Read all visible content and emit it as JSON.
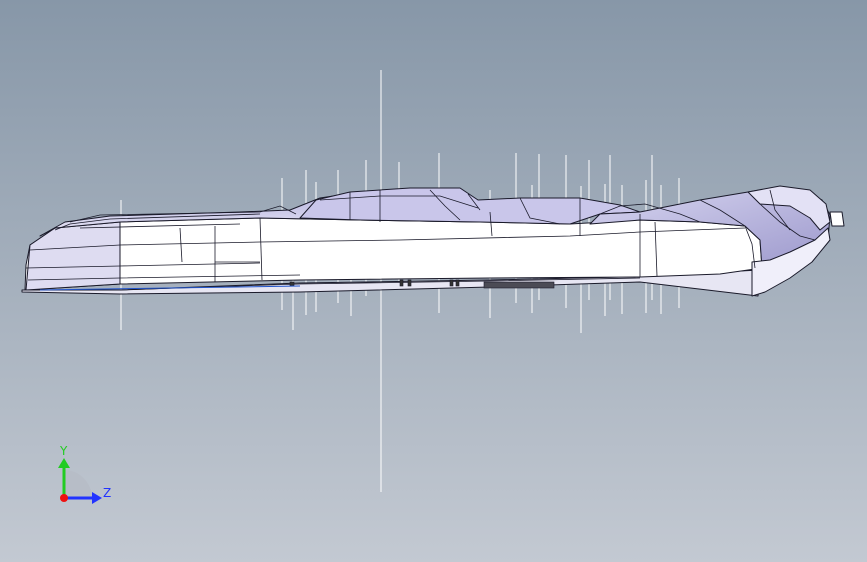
{
  "viewport": {
    "background_top": "#8797a8",
    "background_bottom": "#c3c9d2",
    "model_fill": "#ffffff",
    "model_shade": "#c5c3e6",
    "model_edge": "#1a1a2a",
    "reference_line_color": "#ffffff"
  },
  "triad": {
    "y_label": "Y",
    "z_label": "Z",
    "y_color": "#22cc22",
    "z_color": "#2233ff",
    "x_color": "#ee1111"
  }
}
